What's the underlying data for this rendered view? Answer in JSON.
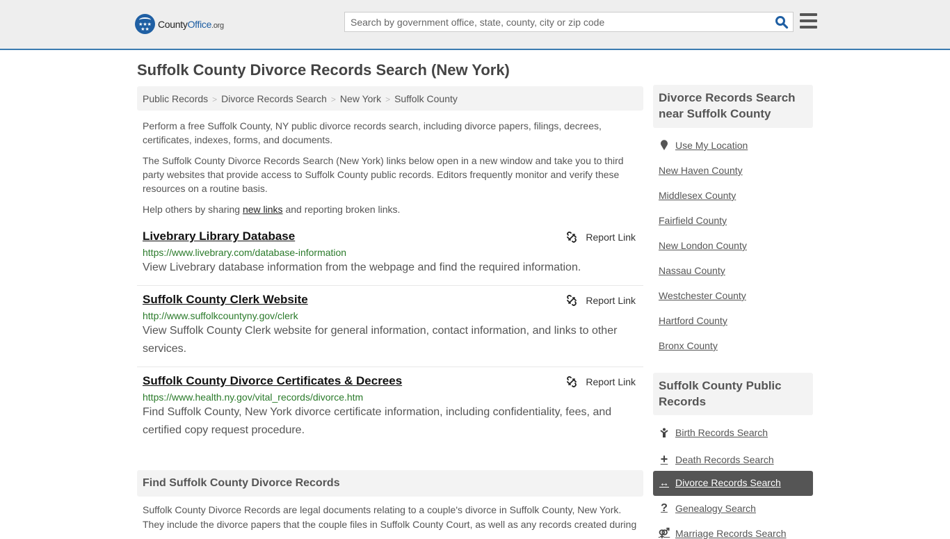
{
  "header": {
    "logo": {
      "name_part1": "County",
      "name_part2": "Office",
      "name_part3": ".org"
    },
    "search": {
      "placeholder": "Search by government office, state, county, city or zip code",
      "value": ""
    },
    "icons": {
      "search": "search-icon",
      "menu": "hamburger-menu-icon"
    }
  },
  "page": {
    "title": "Suffolk County Divorce Records Search (New York)",
    "breadcrumb": [
      "Public Records",
      "Divorce Records Search",
      "New York",
      "Suffolk County"
    ],
    "intro": {
      "p1": "Perform a free Suffolk County, NY public divorce records search, including divorce papers, filings, decrees, certificates, indexes, forms, and documents.",
      "p2": "The Suffolk County Divorce Records Search (New York) links below open in a new window and take you to third party websites that provide access to Suffolk County public records. Editors frequently monitor and verify these resources on a routine basis.",
      "p3_before": "Help others by sharing ",
      "p3_link": "new links",
      "p3_after": " and reporting broken links."
    },
    "report_label": "Report Link",
    "results": [
      {
        "title": "Livebrary Library Database",
        "url": "https://www.livebrary.com/database-information",
        "description": "View Livebrary database information from the webpage and find the required information."
      },
      {
        "title": "Suffolk County Clerk Website",
        "url": "http://www.suffolkcountyny.gov/clerk",
        "description": "View Suffolk County Clerk website for general information, contact information, and links to other services."
      },
      {
        "title": "Suffolk County Divorce Certificates & Decrees",
        "url": "https://www.health.ny.gov/vital_records/divorce.htm",
        "description": "Find Suffolk County, New York divorce certificate information, including confidentiality, fees, and certified copy request procedure."
      }
    ],
    "find_section": {
      "heading": "Find Suffolk County Divorce Records",
      "body": "Suffolk County Divorce Records are legal documents relating to a couple's divorce in Suffolk County, New York. They include the divorce papers that the couple files in Suffolk County Court, as well as any records created during"
    }
  },
  "sidebar": {
    "nearby": {
      "heading": "Divorce Records Search near Suffolk County",
      "use_location": "Use My Location",
      "counties": [
        "New Haven County",
        "Middlesex County",
        "Fairfield County",
        "New London County",
        "Nassau County",
        "Westchester County",
        "Hartford County",
        "Bronx County"
      ]
    },
    "public_records": {
      "heading": "Suffolk County Public Records",
      "items": [
        {
          "label": "Birth Records Search",
          "icon": "child-icon",
          "active": false
        },
        {
          "label": "Death Records Search",
          "icon": "plus-icon",
          "active": false
        },
        {
          "label": "Divorce Records Search",
          "icon": "arrows-horizontal-icon",
          "active": true
        },
        {
          "label": "Genealogy Search",
          "icon": "question-icon",
          "active": false
        },
        {
          "label": "Marriage Records Search",
          "icon": "marriage-icon",
          "active": false
        }
      ]
    }
  },
  "colors": {
    "brand_blue": "#1f5fa3",
    "header_border": "#3b7bb0",
    "url_green": "#2a7a2a",
    "active_bg": "#555555"
  }
}
